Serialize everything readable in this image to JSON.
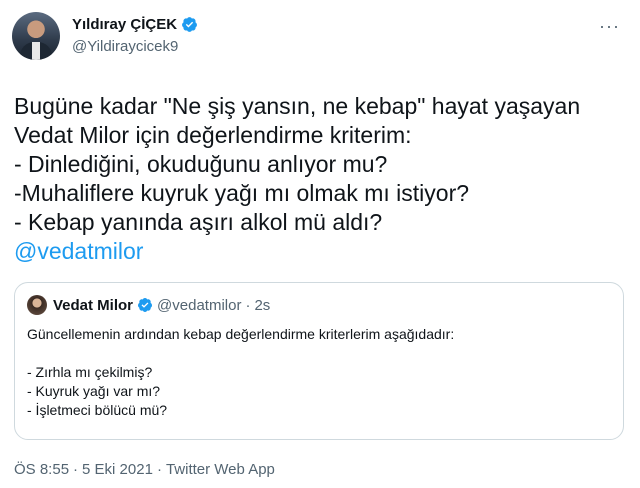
{
  "author": {
    "name": "Yıldıray ÇİÇEK",
    "handle": "@Yildiraycicek9"
  },
  "more_icon": "more-options-icon",
  "tweet": {
    "lines": [
      "Bugüne kadar \"Ne şiş yansın, ne kebap\" hayat yaşayan",
      "Vedat Milor için değerlendirme kriterim:",
      "- Dinlediğini, okuduğunu anlıyor mu?",
      "-Muhaliflere kuyruk yağı mı olmak mı istiyor?",
      "- Kebap yanında aşırı alkol mü aldı?"
    ],
    "mention": "@vedatmilor"
  },
  "quote": {
    "name": "Vedat Milor",
    "handle": "@vedatmilor",
    "separator": "·",
    "time": "2s",
    "intro": "Güncellemenin ardından kebap değerlendirme kriterlerim aşağıdadır:",
    "items": [
      "- Zırhla mı çekilmiş?",
      "- Kuyruk yağı var mı?",
      "- İşletmeci bölücü mü?"
    ]
  },
  "meta": {
    "time": "ÖS 8:55",
    "date": "5 Eki 2021",
    "app": "Twitter Web App",
    "separator": "·"
  },
  "colors": {
    "verified": "#1d9bf0",
    "link": "#1d9bf0",
    "secondary_text": "#536471",
    "border": "#cfd9de"
  }
}
